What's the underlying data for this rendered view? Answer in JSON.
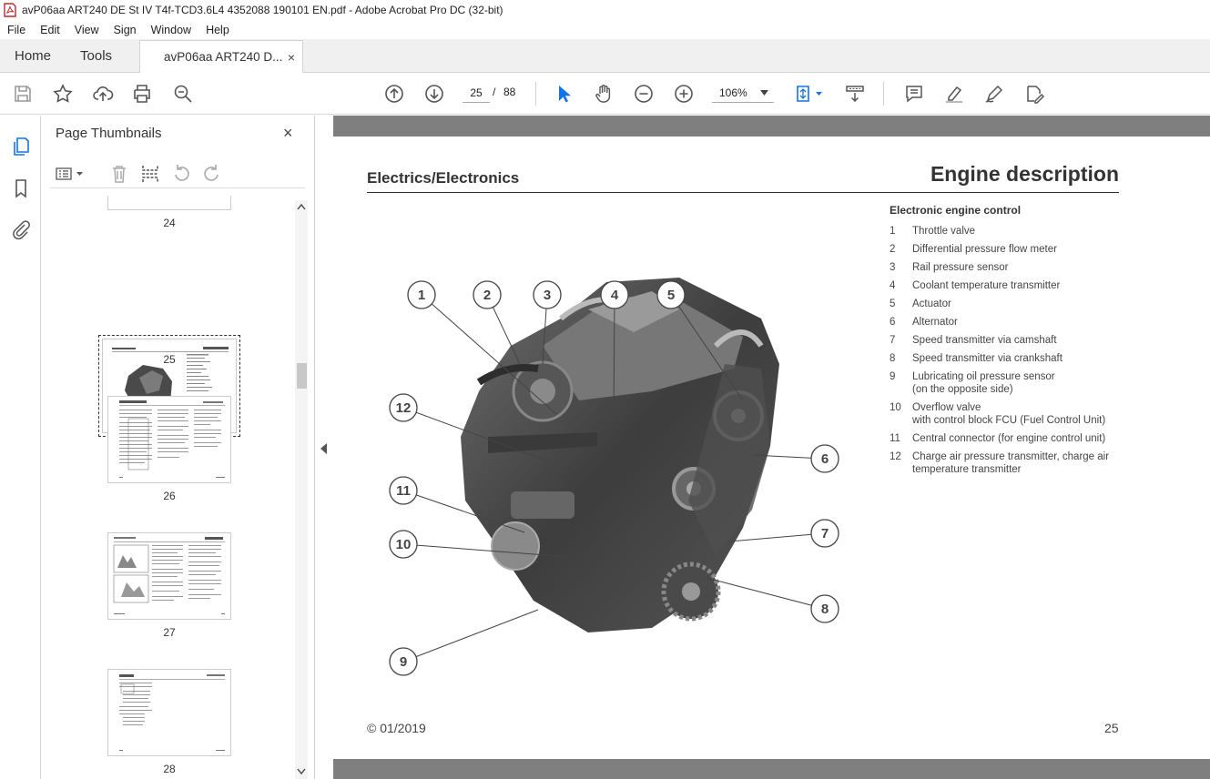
{
  "window": {
    "title": "avP06aa ART240 DE St IV T4f-TCD3.6L4 4352088 190101 EN.pdf - Adobe Acrobat Pro DC (32-bit)"
  },
  "menu": [
    "File",
    "Edit",
    "View",
    "Sign",
    "Window",
    "Help"
  ],
  "tabs": {
    "home": "Home",
    "tools": "Tools",
    "document": "avP06aa ART240 D...",
    "close": "×"
  },
  "toolbar": {
    "current_page": "25",
    "page_sep": "/",
    "total_pages": "88",
    "zoom": "106%"
  },
  "thumbnails_panel": {
    "title": "Page Thumbnails",
    "close": "×",
    "pages": [
      {
        "label": "24"
      },
      {
        "label": "25",
        "selected": true
      },
      {
        "label": "26"
      },
      {
        "label": "27"
      },
      {
        "label": "28"
      }
    ]
  },
  "document_page": {
    "section": "Electrics/Electronics",
    "heading": "Engine description",
    "legend_title": "Electronic engine control",
    "legend": [
      {
        "num": "1",
        "text": "Throttle valve"
      },
      {
        "num": "2",
        "text": "Differential pressure flow meter"
      },
      {
        "num": "3",
        "text": "Rail pressure sensor"
      },
      {
        "num": "4",
        "text": "Coolant temperature transmitter"
      },
      {
        "num": "5",
        "text": "Actuator"
      },
      {
        "num": "6",
        "text": "Alternator"
      },
      {
        "num": "7",
        "text": "Speed transmitter via camshaft"
      },
      {
        "num": "8",
        "text": "Speed transmitter via crankshaft"
      },
      {
        "num": "9",
        "text": "Lubricating oil pressure sensor\n(on the opposite side)"
      },
      {
        "num": "10",
        "text": "Overflow valve\nwith control block FCU (Fuel Control Unit)"
      },
      {
        "num": "11",
        "text": "Central connector (for engine control unit)"
      },
      {
        "num": "12",
        "text": "Charge air pressure transmitter, charge air\ntemperature transmitter"
      }
    ],
    "callouts": [
      "1",
      "2",
      "3",
      "4",
      "5",
      "6",
      "7",
      "8",
      "9",
      "10",
      "11",
      "12"
    ],
    "footer_left": "© 01/2019",
    "footer_right": "25"
  },
  "icons": {
    "save": "save-icon",
    "bookmark": "star-icon",
    "upload": "upload-icon",
    "print": "print-icon",
    "find": "search-zoom-icon",
    "prev": "arrow-up-circle-icon",
    "next": "arrow-down-circle-icon",
    "select": "pointer-icon",
    "hand": "hand-icon",
    "zoom_out": "zoom-out-icon",
    "zoom_in": "zoom-in-icon",
    "fit": "fit-page-icon",
    "scroll": "scroll-mode-icon",
    "comment": "comment-icon",
    "highlight": "highlight-icon",
    "draw": "draw-icon",
    "fill_sign": "fill-sign-icon"
  },
  "colors": {
    "accent": "#1473e6",
    "viewer_bg": "#7f7f7f"
  }
}
